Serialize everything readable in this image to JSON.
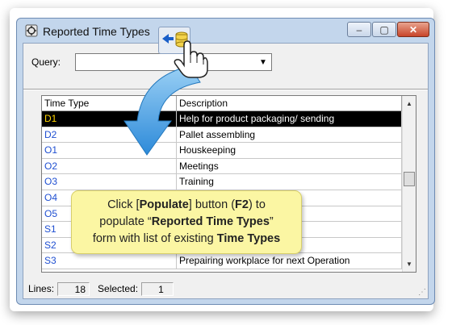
{
  "window": {
    "title": "Reported Time Types",
    "minimize_glyph": "–",
    "maximize_glyph": "▢",
    "close_glyph": "✕"
  },
  "query": {
    "label": "Query:",
    "value": "",
    "dropdown_glyph": "▼"
  },
  "grid": {
    "columns": [
      "Time Type",
      "Description"
    ],
    "rows": [
      {
        "code": "D1",
        "description": "Help for product packaging/ sending",
        "selected": true
      },
      {
        "code": "D2",
        "description": "Pallet assembling",
        "selected": false
      },
      {
        "code": "O1",
        "description": "Houskeeping",
        "selected": false
      },
      {
        "code": "O2",
        "description": "Meetings",
        "selected": false
      },
      {
        "code": "O3",
        "description": "Training",
        "selected": false
      },
      {
        "code": "O4",
        "description": "",
        "selected": false
      },
      {
        "code": "O5",
        "description": "",
        "selected": false
      },
      {
        "code": "S1",
        "description": "",
        "selected": false
      },
      {
        "code": "S2",
        "description": "",
        "selected": false
      },
      {
        "code": "S3",
        "description": "Prepairing workplace for next Operation",
        "selected": false
      }
    ],
    "scroll_up_glyph": "▲",
    "scroll_down_glyph": "▼"
  },
  "status": {
    "lines_label": "Lines:",
    "lines_value": "18",
    "selected_label": "Selected:",
    "selected_value": "1"
  },
  "callout": {
    "part1": "Click [",
    "populate": "Populate",
    "part2": "] button (",
    "key": "F2",
    "part3": ") to",
    "line2_a": "populate “",
    "form_name": "Reported Time Types",
    "line2_b": "”",
    "line3_a": "form with list of existing ",
    "time_types": "Time Types"
  },
  "colors": {
    "code_text": "#1f4fd1",
    "selected_row_bg": "#000000",
    "selected_code": "#ffd400",
    "callout_bg": "#fbf6a3",
    "arrow": "#3b9be0"
  }
}
